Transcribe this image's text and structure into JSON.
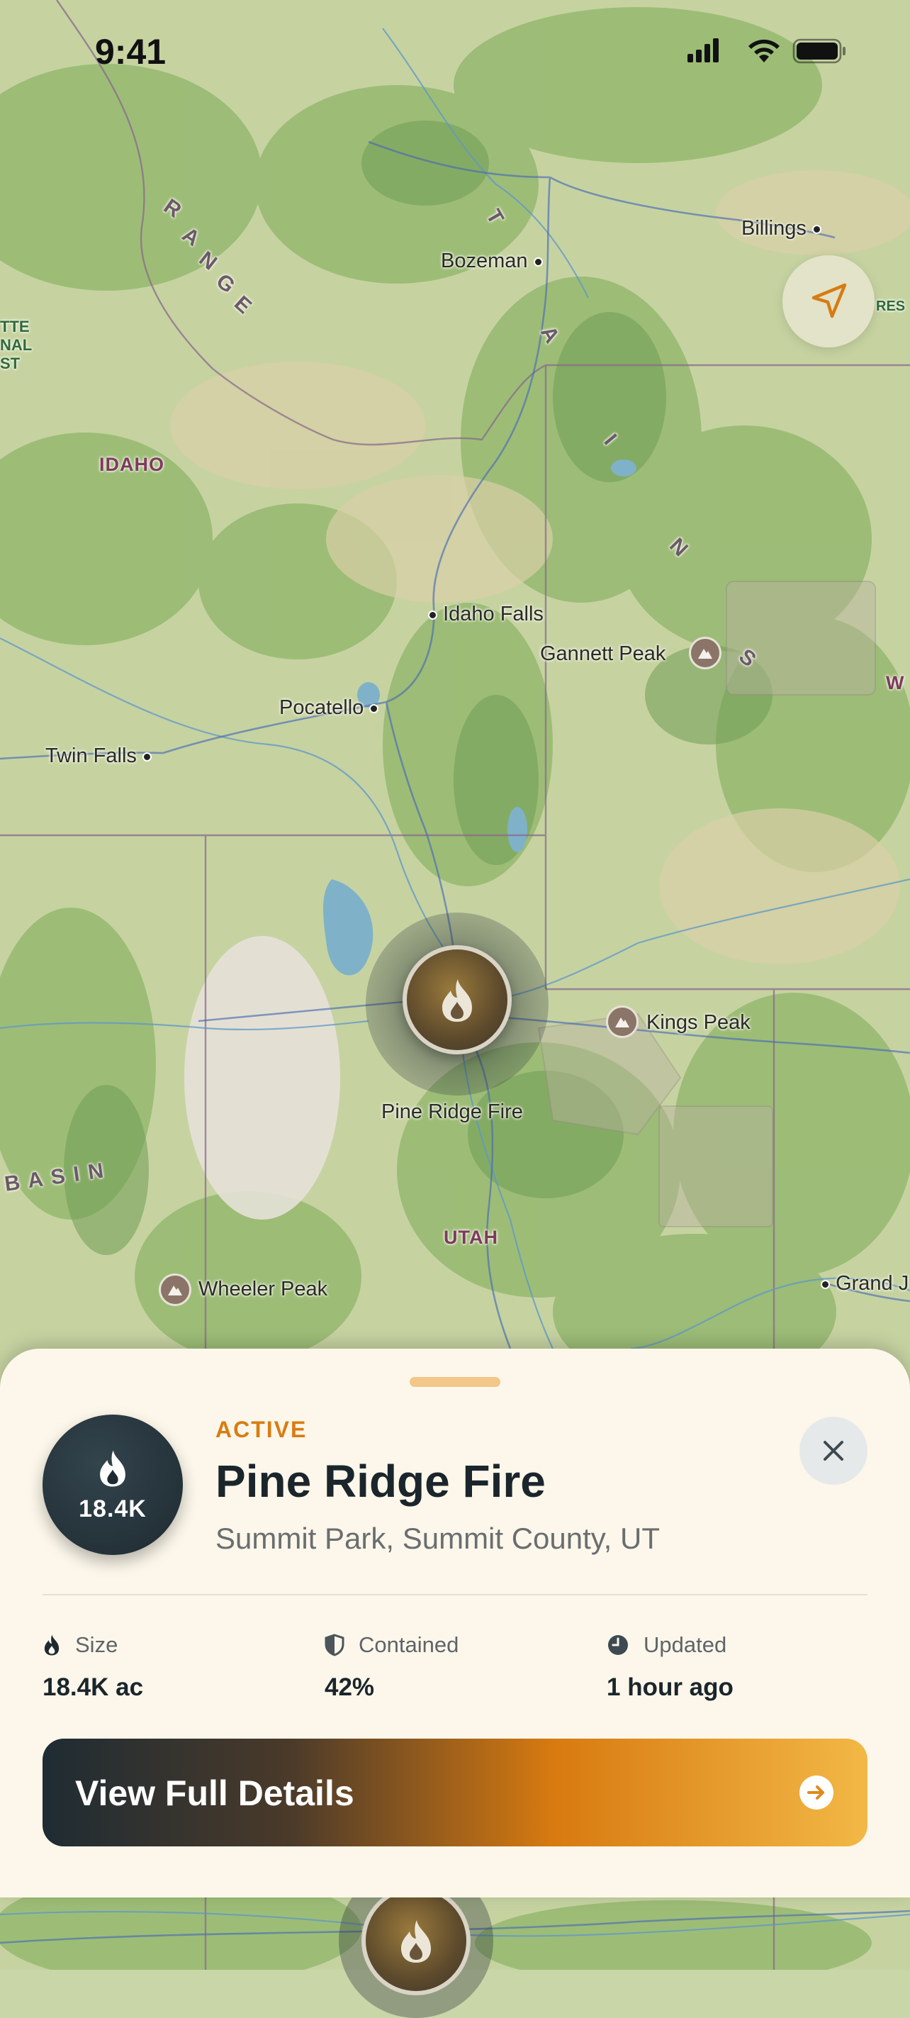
{
  "status_bar": {
    "time": "9:41"
  },
  "map": {
    "labels": {
      "billings": "Billings",
      "bozeman": "Bozeman",
      "idaho_falls": "Idaho Falls",
      "pocatello": "Pocatello",
      "twin_falls": "Twin Falls",
      "gannett_peak": "Gannett Peak",
      "kings_peak": "Kings Peak",
      "wheeler_peak": "Wheeler Peak",
      "grand_junction": "Grand J",
      "pine_ridge_fire": "Pine Ridge Fire",
      "idaho": "IDAHO",
      "utah": "UTAH",
      "wyoming_partial": "W",
      "res_partial": "RES",
      "basin": "B A S I N",
      "range_r": "R",
      "range_a": "A",
      "range_n": "N",
      "range_g": "G",
      "range_e": "E",
      "mtn_t": "T",
      "mtn_a": "A",
      "mtn_i": "I",
      "mtn_n": "N",
      "mtn_s": "S",
      "forest_line1": "TTE",
      "forest_line2": "NAL",
      "forest_line3": "ST"
    }
  },
  "sheet": {
    "badge_value": "18.4K",
    "status": "ACTIVE",
    "name": "Pine Ridge Fire",
    "location": "Summit Park, Summit County, UT",
    "stats": [
      {
        "label": "Size",
        "value": "18.4K ac",
        "icon": "flame-icon"
      },
      {
        "label": "Contained",
        "value": "42%",
        "icon": "shield-icon"
      },
      {
        "label": "Updated",
        "value": "1 hour ago",
        "icon": "clock-icon"
      }
    ],
    "cta_label": "View Full Details"
  },
  "colors": {
    "accent_orange": "#d97c12",
    "dark_slate": "#1e2a31",
    "sheet_bg": "#fcf7ea"
  }
}
